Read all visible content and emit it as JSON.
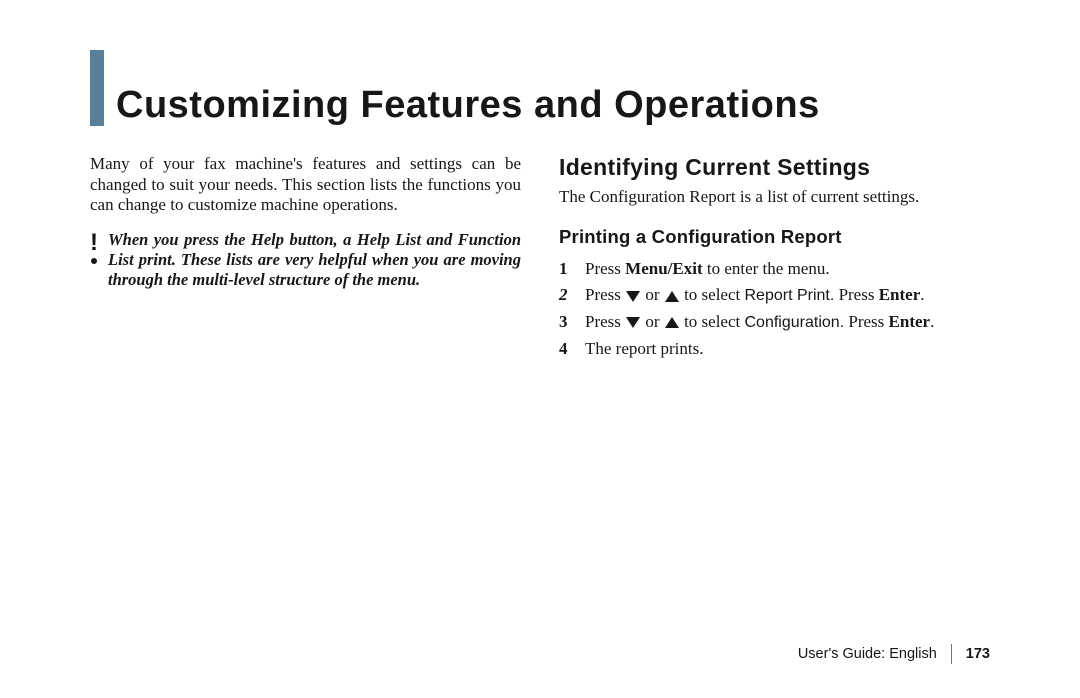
{
  "chapter": {
    "title": "Customizing Features and Operations"
  },
  "left": {
    "intro": "Many of your fax machine's features and settings can be changed to suit your needs.  This section lists the functions you can change to customize machine operations.",
    "noteGlyph": "!",
    "note": "When you press the Help button, a Help List and Function List print.  These lists are very helpful when you are moving through the multi-level structure of the menu."
  },
  "right": {
    "h2": "Identifying Current Settings",
    "p1": "The Configuration Report is a list of current settings.",
    "h3": "Printing a Configuration Report",
    "steps": [
      {
        "n": "1",
        "pre": "Press ",
        "bold": "Menu/Exit",
        "post": " to enter the menu."
      },
      {
        "n": "2",
        "italic": true,
        "pre": "Press ",
        "sans": "Report Print.",
        "enter": "Enter"
      },
      {
        "n": "3",
        "pre": "Press ",
        "sans": "Configuration.",
        "enter": "Enter"
      },
      {
        "n": "4",
        "text": "The report prints."
      }
    ],
    "orSelect": " or ",
    "toSelect": " to select ",
    "pressWord": " Press "
  },
  "footer": {
    "guide": "User's Guide:  English",
    "page": "173"
  }
}
